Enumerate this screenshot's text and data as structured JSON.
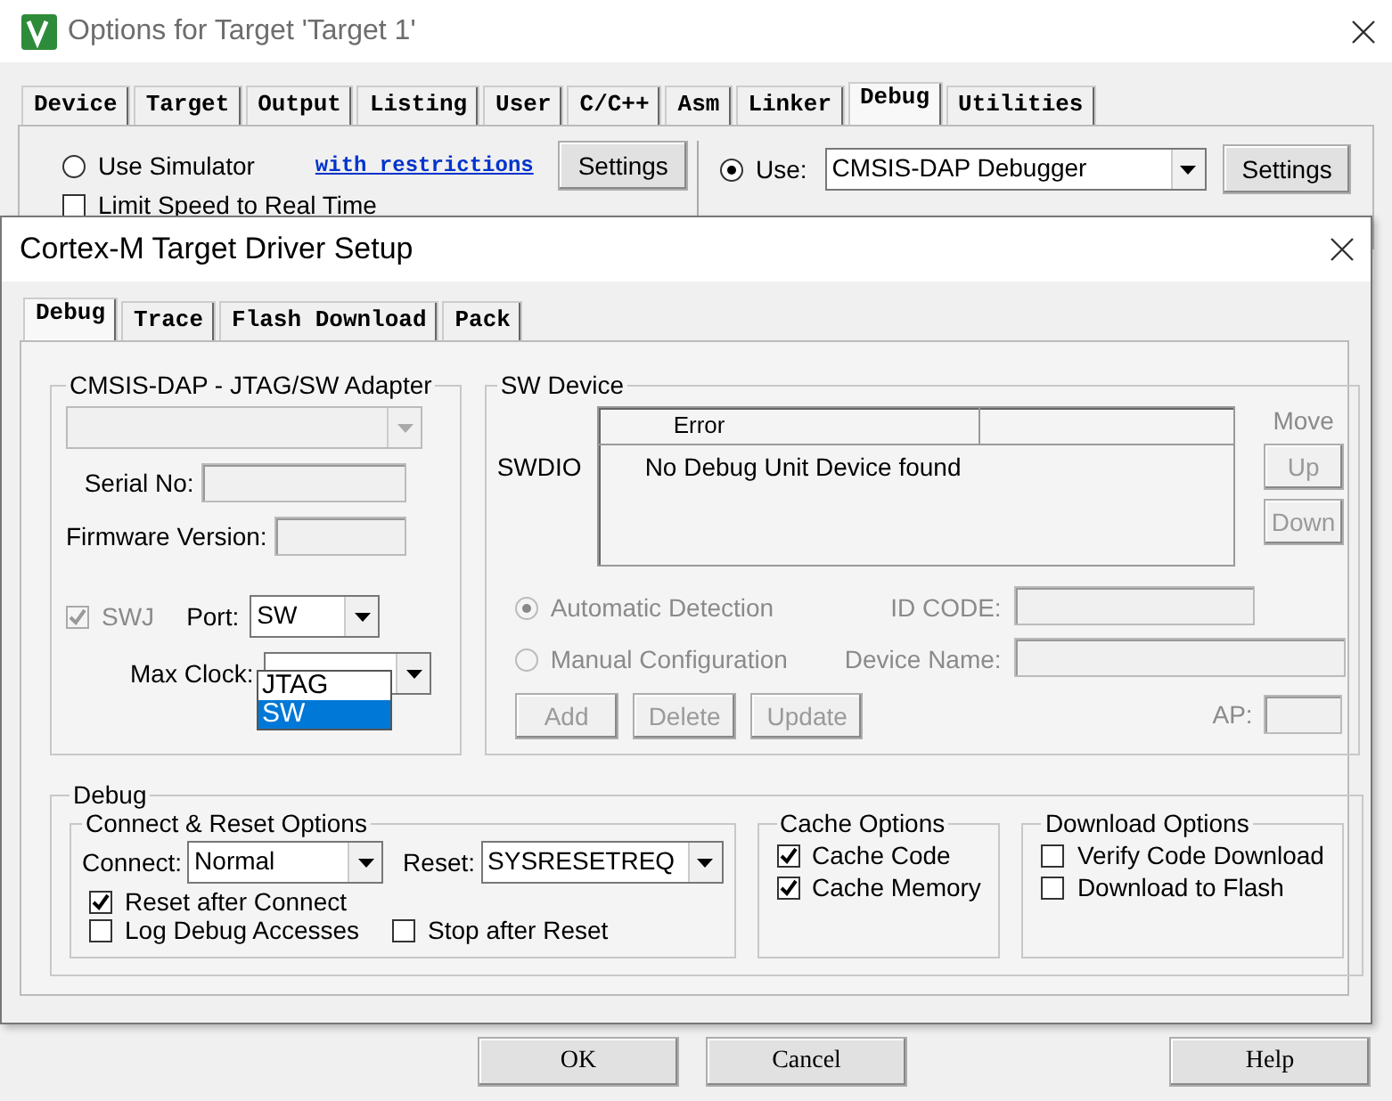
{
  "window": {
    "title": "Options for Target 'Target 1'"
  },
  "tabs": [
    {
      "label": "Device",
      "selected": false
    },
    {
      "label": "Target",
      "selected": false
    },
    {
      "label": "Output",
      "selected": false
    },
    {
      "label": "Listing",
      "selected": false
    },
    {
      "label": "User",
      "selected": false
    },
    {
      "label": "C/C++",
      "selected": false
    },
    {
      "label": "Asm",
      "selected": false
    },
    {
      "label": "Linker",
      "selected": false
    },
    {
      "label": "Debug",
      "selected": true
    },
    {
      "label": "Utilities",
      "selected": false
    }
  ],
  "debug_panel": {
    "simulator": {
      "label": "Use Simulator",
      "selected": false
    },
    "restrictions_link": "with restrictions",
    "settings_left": "Settings",
    "limit_speed": {
      "label": "Limit Speed to Real Time",
      "checked": false
    },
    "use": {
      "label": "Use:",
      "selected": true
    },
    "debugger": "CMSIS-DAP Debugger",
    "settings_right": "Settings"
  },
  "dialog": {
    "title": "Cortex-M Target Driver Setup",
    "tabs": [
      {
        "label": "Debug",
        "selected": true
      },
      {
        "label": "Trace",
        "selected": false
      },
      {
        "label": "Flash Download",
        "selected": false
      },
      {
        "label": "Pack",
        "selected": false
      }
    ],
    "adapter": {
      "title": "CMSIS-DAP - JTAG/SW Adapter",
      "serial_label": "Serial No:",
      "firmware_label": "Firmware Version:",
      "swj": {
        "label": "SWJ",
        "checked": true,
        "disabled": true
      },
      "port_label": "Port:",
      "port_value": "SW",
      "port_options": [
        {
          "label": "JTAG",
          "selected": false
        },
        {
          "label": "SW",
          "selected": true
        }
      ],
      "max_clock_label": "Max Clock:"
    },
    "sw_device": {
      "title": "SW Device",
      "row_label": "SWDIO",
      "columns": [
        "Error"
      ],
      "message": "No Debug Unit Device found",
      "move_label": "Move",
      "up": "Up",
      "down": "Down",
      "detection": [
        {
          "label": "Automatic Detection",
          "selected": true
        },
        {
          "label": "Manual Configuration",
          "selected": false
        }
      ],
      "id_code_label": "ID CODE:",
      "device_name_label": "Device Name:",
      "buttons": [
        "Add",
        "Delete",
        "Update"
      ],
      "ap_label": "AP:"
    },
    "debug": {
      "title": "Debug",
      "connect_reset": {
        "title": "Connect & Reset Options",
        "connect_label": "Connect:",
        "connect_value": "Normal",
        "reset_label": "Reset:",
        "reset_value": "SYSRESETREQ",
        "options": [
          {
            "label": "Reset after Connect",
            "checked": true
          },
          {
            "label": "Log Debug Accesses",
            "checked": false
          },
          {
            "label": "Stop after Reset",
            "checked": false
          }
        ]
      },
      "cache": {
        "title": "Cache Options",
        "options": [
          {
            "label": "Cache Code",
            "checked": true
          },
          {
            "label": "Cache Memory",
            "checked": true
          }
        ]
      },
      "download": {
        "title": "Download Options",
        "options": [
          {
            "label": "Verify Code Download",
            "checked": false
          },
          {
            "label": "Download to Flash",
            "checked": false
          }
        ]
      }
    }
  },
  "buttons": [
    "OK",
    "Cancel",
    "Help"
  ]
}
